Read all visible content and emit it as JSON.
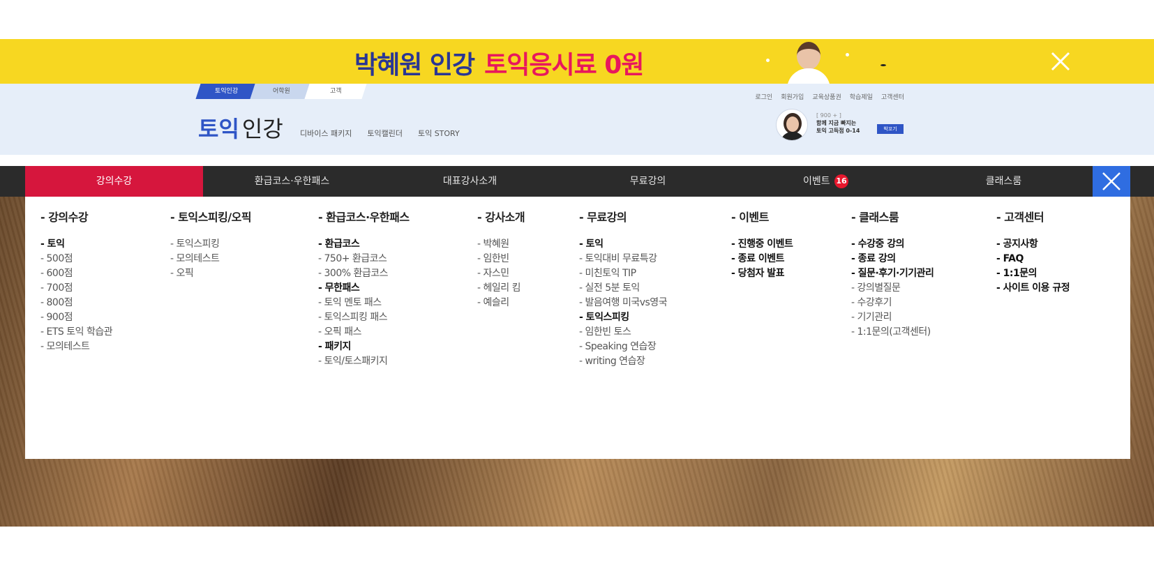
{
  "promo": {
    "text_a": "박혜원 인강",
    "text_b": "토익응시료 0원",
    "accent_color": "#f7d721",
    "close_icon": "close-icon"
  },
  "header": {
    "site_tabs": [
      "토익인강",
      "어학원",
      "고객"
    ],
    "util_links": [
      "로그인",
      "회원가입",
      "교육상품권",
      "학습제일",
      "고객센터"
    ],
    "logo_main": "토익",
    "logo_sub": "인강",
    "links": [
      "디바이스 패키지",
      "토익캘린더",
      "토익 STORY"
    ],
    "teacher": {
      "line1": "[ 900 + ]",
      "line2": "함께 지금 빠지는",
      "line3": "토익 고득점 0-14",
      "button": "박꼬기"
    }
  },
  "nav": {
    "items": [
      {
        "label": "강의수강",
        "badge": ""
      },
      {
        "label": "환급코스·우한패스",
        "badge": ""
      },
      {
        "label": "대표강사소개",
        "badge": ""
      },
      {
        "label": "무료강의",
        "badge": ""
      },
      {
        "label": "이벤트",
        "badge": "16"
      },
      {
        "label": "클래스룸",
        "badge": ""
      }
    ],
    "active_color": "#d6163d"
  },
  "mega_menu": [
    {
      "title": "- 강의수강",
      "items": [
        {
          "label": "- 토익",
          "strong": true
        },
        {
          "label": "- 500점",
          "strong": false
        },
        {
          "label": "- 600점",
          "strong": false
        },
        {
          "label": "- 700점",
          "strong": false
        },
        {
          "label": "- 800점",
          "strong": false
        },
        {
          "label": "- 900점",
          "strong": false
        },
        {
          "label": "- ETS 토익 학습관",
          "strong": false
        },
        {
          "label": "- 모의테스트",
          "strong": false
        }
      ]
    },
    {
      "title": "- 토익스피킹/오픽",
      "items": [
        {
          "label": "- 토익스피킹",
          "strong": false
        },
        {
          "label": "- 모의테스트",
          "strong": false
        },
        {
          "label": "- 오픽",
          "strong": false
        }
      ]
    },
    {
      "title": "- 환급코스·우한패스",
      "items": [
        {
          "label": "- 환급코스",
          "strong": true
        },
        {
          "label": "- 750+ 환급코스",
          "strong": false
        },
        {
          "label": "- 300% 환급코스",
          "strong": false
        },
        {
          "label": "- 무한패스",
          "strong": true
        },
        {
          "label": "- 토익 멘토 패스",
          "strong": false
        },
        {
          "label": "- 토익스피킹 패스",
          "strong": false
        },
        {
          "label": "- 오픽 패스",
          "strong": false
        },
        {
          "label": "- 패키지",
          "strong": true
        },
        {
          "label": "- 토익/토스패키지",
          "strong": false
        }
      ]
    },
    {
      "title": "- 강사소개",
      "items": [
        {
          "label": "- 박혜원",
          "strong": false
        },
        {
          "label": "- 임한빈",
          "strong": false
        },
        {
          "label": "- 자스민",
          "strong": false
        },
        {
          "label": "- 헤일리 킴",
          "strong": false
        },
        {
          "label": "- 예슬리",
          "strong": false
        }
      ]
    },
    {
      "title": "- 무료강의",
      "items": [
        {
          "label": "- 토익",
          "strong": true
        },
        {
          "label": "- 토익대비 무료특강",
          "strong": false
        },
        {
          "label": "- 미친토익 TIP",
          "strong": false
        },
        {
          "label": "- 실전 5분 토익",
          "strong": false
        },
        {
          "label": "- 발음여행 미국vs영국",
          "strong": false
        },
        {
          "label": "- 토익스피킹",
          "strong": true
        },
        {
          "label": "- 임한빈 토스",
          "strong": false
        },
        {
          "label": "- Speaking 연습장",
          "strong": false
        },
        {
          "label": "- writing 연습장",
          "strong": false
        }
      ]
    },
    {
      "title": "- 이벤트",
      "items": [
        {
          "label": "- 진행중 이벤트",
          "strong": true
        },
        {
          "label": "- 종료 이벤트",
          "strong": true
        },
        {
          "label": "- 당첨자 발표",
          "strong": true
        }
      ]
    },
    {
      "title": "- 클래스룸",
      "items": [
        {
          "label": "- 수강중 강의",
          "strong": true
        },
        {
          "label": "- 종료 강의",
          "strong": true
        },
        {
          "label": "- 질문·후기·기기관리",
          "strong": true
        },
        {
          "label": "- 강의별질문",
          "strong": false
        },
        {
          "label": "- 수강후기",
          "strong": false
        },
        {
          "label": "- 기기관리",
          "strong": false
        },
        {
          "label": "- 1:1문의(고객센터)",
          "strong": false
        }
      ]
    },
    {
      "title": "- 고객센터",
      "items": [
        {
          "label": "- 공지사항",
          "strong": true
        },
        {
          "label": "- FAQ",
          "strong": true
        },
        {
          "label": "- 1:1문의",
          "strong": true
        },
        {
          "label": "- 사이트 이용 규정",
          "strong": true
        }
      ]
    }
  ]
}
